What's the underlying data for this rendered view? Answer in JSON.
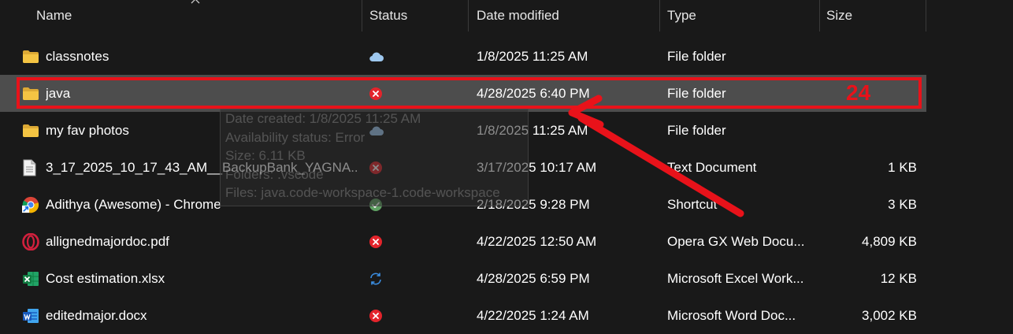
{
  "columns": {
    "name": "Name",
    "status": "Status",
    "date_modified": "Date modified",
    "type": "Type",
    "size": "Size"
  },
  "files": [
    {
      "name": "classnotes",
      "icon": "folder-icon",
      "status": "cloud-icon",
      "date": "1/8/2025 11:25 AM",
      "type": "File folder",
      "size": ""
    },
    {
      "name": "java",
      "icon": "folder-icon",
      "status": "error-icon",
      "date": "4/28/2025 6:40 PM",
      "type": "File folder",
      "size": "",
      "selected": true
    },
    {
      "name": "my fav photos",
      "icon": "folder-icon",
      "status": "cloud-icon",
      "date": "1/8/2025 11:25 AM",
      "type": "File folder",
      "size": ""
    },
    {
      "name": "3_17_2025_10_17_43_AM__BackupBank_YAGNA...",
      "icon": "text-file-icon",
      "status": "error-icon",
      "date": "3/17/2025 10:17 AM",
      "type": "Text Document",
      "size": "1 KB"
    },
    {
      "name": "Adithya (Awesome) - Chrome",
      "icon": "chrome-shortcut-icon",
      "status": "synced-check-icon",
      "date": "2/18/2025 9:28 PM",
      "type": "Shortcut",
      "size": "3 KB"
    },
    {
      "name": "allignedmajordoc.pdf",
      "icon": "opera-gx-icon",
      "status": "error-icon",
      "date": "4/22/2025 12:50 AM",
      "type": "Opera GX Web Docu...",
      "size": "4,809 KB"
    },
    {
      "name": "Cost estimation.xlsx",
      "icon": "excel-icon",
      "status": "sync-icon",
      "date": "4/28/2025 6:59 PM",
      "type": "Microsoft Excel Work...",
      "size": "12 KB"
    },
    {
      "name": "editedmajor.docx",
      "icon": "word-icon",
      "status": "error-icon",
      "date": "4/22/2025 1:24 AM",
      "type": "Microsoft Word Doc...",
      "size": "3,002 KB"
    }
  ],
  "tooltip": {
    "date_created": "Date created: 1/8/2025 11:25 AM",
    "availability": "Availability status: Error",
    "size": "Size: 6.11 KB",
    "folders": "Folders: .vscode",
    "files": "Files: java.code-workspace-1.code-workspace"
  },
  "annotation": {
    "number": "24",
    "color": "#e8121a"
  },
  "colors": {
    "background": "#191919",
    "selected_row": "#4d4d4d",
    "folder": "#f4c443",
    "error": "#e3242b",
    "cloud": "#9ec8ef",
    "sync": "#3b8fe4",
    "check": "#5fa163"
  }
}
